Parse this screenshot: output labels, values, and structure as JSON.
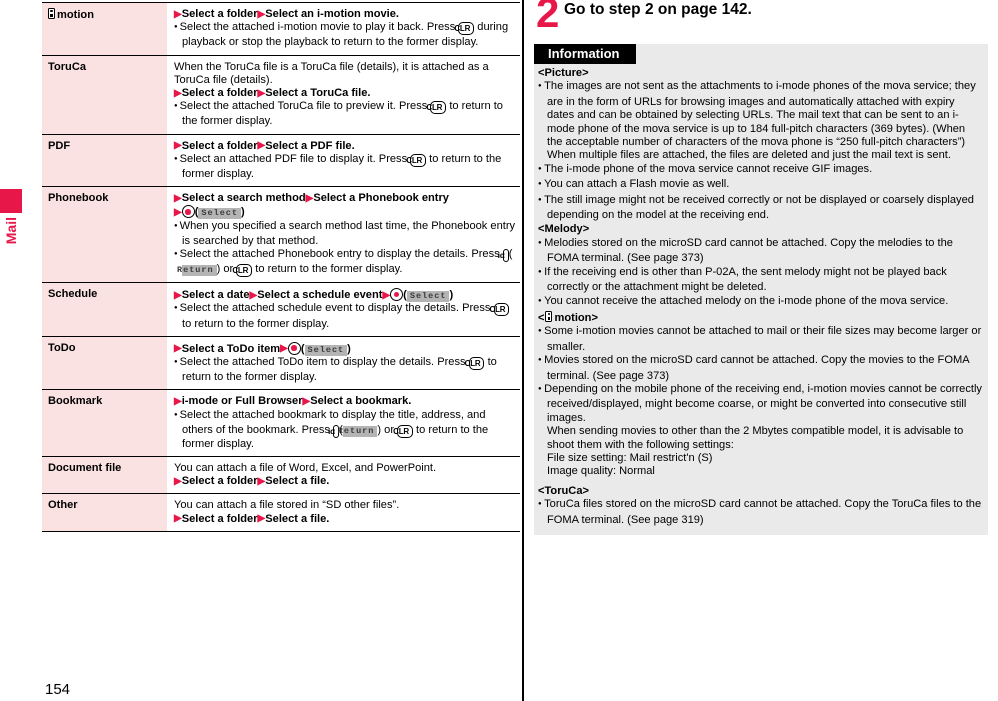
{
  "page": {
    "number": "154",
    "side_tab_label": "Mail"
  },
  "left_table": {
    "rows": [
      {
        "name": "motion",
        "name_has_imotion_icon": true,
        "lines": [
          {
            "type": "steps",
            "parts": [
              "Select a folder",
              "Select an i-motion movie."
            ]
          },
          {
            "type": "bullet",
            "segments": [
              {
                "t": "text",
                "v": "Select the attached i-motion movie to play it back. Press "
              },
              {
                "t": "key",
                "v": "CLR"
              },
              {
                "t": "text",
                "v": " during playback or stop the playback to return to the former display."
              }
            ]
          }
        ]
      },
      {
        "name": "ToruCa",
        "name_has_imotion_icon": false,
        "lines": [
          {
            "type": "plain",
            "segments": [
              {
                "t": "text",
                "v": "When the ToruCa file is a ToruCa file (details), it is attached as a ToruCa file (details)."
              }
            ]
          },
          {
            "type": "steps",
            "parts": [
              "Select a folder",
              "Select a ToruCa file."
            ]
          },
          {
            "type": "bullet",
            "segments": [
              {
                "t": "text",
                "v": "Select the attached ToruCa file to preview it. Press "
              },
              {
                "t": "key",
                "v": "CLR"
              },
              {
                "t": "text",
                "v": " to return to the former display."
              }
            ]
          }
        ]
      },
      {
        "name": "PDF",
        "name_has_imotion_icon": false,
        "lines": [
          {
            "type": "steps",
            "parts": [
              "Select a folder",
              "Select a PDF file."
            ]
          },
          {
            "type": "bullet",
            "segments": [
              {
                "t": "text",
                "v": "Select an attached PDF file to display it. Press "
              },
              {
                "t": "key",
                "v": "CLR"
              },
              {
                "t": "text",
                "v": " to return to the former display."
              }
            ]
          }
        ]
      },
      {
        "name": "Phonebook",
        "name_has_imotion_icon": false,
        "lines": [
          {
            "type": "steps_select",
            "parts": [
              "Select a search method",
              "Select a Phonebook entry"
            ],
            "softkey": "Select"
          },
          {
            "type": "bullet",
            "segments": [
              {
                "t": "text",
                "v": "When you specified a search method last time, the Phonebook entry is searched by that method."
              }
            ]
          },
          {
            "type": "bullet",
            "segments": [
              {
                "t": "text",
                "v": "Select the attached Phonebook entry to display the details. Press "
              },
              {
                "t": "key_ir",
                "v": "iR"
              },
              {
                "t": "text",
                "v": "("
              },
              {
                "t": "softkey_light",
                "v": "Return"
              },
              {
                "t": "text",
                "v": ") or "
              },
              {
                "t": "key",
                "v": "CLR"
              },
              {
                "t": "text",
                "v": " to return to the former display."
              }
            ]
          }
        ]
      },
      {
        "name": "Schedule",
        "name_has_imotion_icon": false,
        "lines": [
          {
            "type": "steps_inline_select",
            "parts": [
              "Select a date",
              "Select a schedule event"
            ],
            "softkey": "Select"
          },
          {
            "type": "bullet",
            "segments": [
              {
                "t": "text",
                "v": "Select the attached schedule event to display the details. Press "
              },
              {
                "t": "key",
                "v": "CLR"
              },
              {
                "t": "text",
                "v": " to return to the former display."
              }
            ]
          }
        ]
      },
      {
        "name": "ToDo",
        "name_has_imotion_icon": false,
        "lines": [
          {
            "type": "steps_inline_select",
            "parts": [
              "Select a ToDo item"
            ],
            "softkey": "Select"
          },
          {
            "type": "bullet",
            "segments": [
              {
                "t": "text",
                "v": "Select the attached ToDo item to display the details. Press "
              },
              {
                "t": "key",
                "v": "CLR"
              },
              {
                "t": "text",
                "v": " to return to the former display."
              }
            ]
          }
        ]
      },
      {
        "name": "Bookmark",
        "name_has_imotion_icon": false,
        "lines": [
          {
            "type": "steps",
            "parts": [
              "i-mode or Full Browser",
              "Select a bookmark."
            ]
          },
          {
            "type": "bullet",
            "segments": [
              {
                "t": "text",
                "v": "Select the attached bookmark to display the title, address, and others of the bookmark. Press "
              },
              {
                "t": "key_ir",
                "v": "iR"
              },
              {
                "t": "text",
                "v": "("
              },
              {
                "t": "softkey_light",
                "v": "Return"
              },
              {
                "t": "text",
                "v": ") or "
              },
              {
                "t": "key",
                "v": "CLR"
              },
              {
                "t": "text",
                "v": " to return to the former display."
              }
            ]
          }
        ]
      },
      {
        "name": "Document file",
        "name_has_imotion_icon": false,
        "lines": [
          {
            "type": "plain",
            "segments": [
              {
                "t": "text",
                "v": "You can attach a file of Word, Excel, and PowerPoint."
              }
            ]
          },
          {
            "type": "steps",
            "parts": [
              "Select a folder",
              "Select a file."
            ]
          }
        ]
      },
      {
        "name": "Other",
        "name_has_imotion_icon": false,
        "lines": [
          {
            "type": "plain",
            "segments": [
              {
                "t": "text",
                "v": "You can attach a file stored in “SD other files”."
              }
            ]
          },
          {
            "type": "steps",
            "parts": [
              "Select a folder",
              "Select a file."
            ]
          }
        ]
      }
    ]
  },
  "right_column": {
    "step_number": "2",
    "step_title": "Go to step 2 on page 142.",
    "information_header": "Information",
    "information_blocks": [
      {
        "kind": "section",
        "text": "<Picture>"
      },
      {
        "kind": "bullet",
        "text": "The images are not sent as the attachments to i-mode phones of the mova service; they are in the form of URLs for browsing images and automatically attached with expiry dates and can be obtained by selecting URLs. The mail text that can be sent to an i-mode phone of the mova service is up to 184 full-pitch characters (369 bytes). (When the acceptable number of characters of the mova phone is “250 full-pitch characters”)"
      },
      {
        "kind": "cont",
        "text": "When multiple files are attached, the files are deleted and just the mail text is sent."
      },
      {
        "kind": "bullet",
        "text": "The i-mode phone of the mova service cannot receive GIF images."
      },
      {
        "kind": "bullet",
        "text": "You can attach a Flash movie as well."
      },
      {
        "kind": "bullet",
        "text": "The still image might not be received correctly or not be displayed or coarsely displayed depending on the model at the receiving end."
      },
      {
        "kind": "section",
        "text": "<Melody>"
      },
      {
        "kind": "bullet",
        "text": "Melodies stored on the microSD card cannot be attached. Copy the melodies to the FOMA terminal. (See page 373)"
      },
      {
        "kind": "bullet",
        "text": "If the receiving end is other than P-02A, the sent melody might not be played back correctly or the attachment might be deleted."
      },
      {
        "kind": "bullet",
        "text": "You cannot receive the attached melody on the i-mode phone of the mova service."
      },
      {
        "kind": "section_imotion",
        "prefix": "<",
        "text": "motion>"
      },
      {
        "kind": "bullet",
        "text": "Some i-motion movies cannot be attached to mail or their file sizes may become larger or smaller."
      },
      {
        "kind": "bullet",
        "text": "Movies stored on the microSD card cannot be attached. Copy the movies to the FOMA terminal. (See page 373)"
      },
      {
        "kind": "bullet",
        "text": "Depending on the mobile phone of the receiving end, i-motion movies cannot be correctly received/displayed, might become coarse, or might be converted into consecutive still images."
      },
      {
        "kind": "cont",
        "text": "When sending movies to other than the 2 Mbytes compatible model, it is advisable to shoot them with the following settings:"
      },
      {
        "kind": "cont",
        "text": "File size setting: Mail restrict'n (S)"
      },
      {
        "kind": "cont",
        "text": "Image quality: Normal"
      },
      {
        "kind": "section_spaced",
        "text": "<ToruCa>"
      },
      {
        "kind": "bullet",
        "text": "ToruCa files stored on the microSD card cannot be attached. Copy the ToruCa files to the FOMA terminal. (See page 319)"
      }
    ]
  },
  "colors": {
    "accent_red": "#e8174a",
    "row_name_bg": "#fbe2e2",
    "info_bg": "#eaeaea",
    "info_header_bg": "#000000"
  }
}
